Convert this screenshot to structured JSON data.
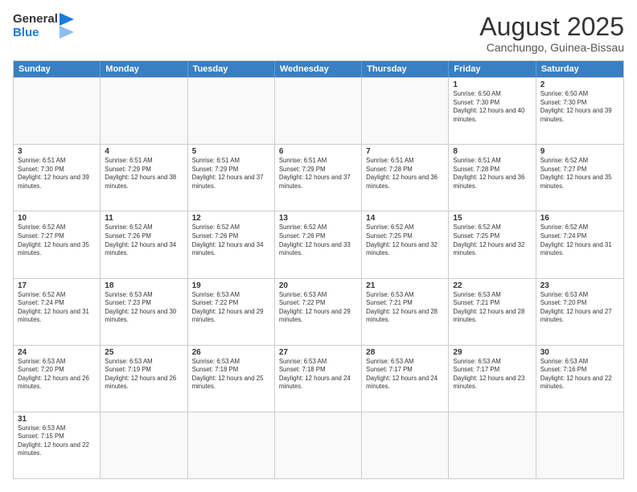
{
  "header": {
    "logo_general": "General",
    "logo_blue": "Blue",
    "month_year": "August 2025",
    "location": "Canchungo, Guinea-Bissau"
  },
  "weekdays": [
    "Sunday",
    "Monday",
    "Tuesday",
    "Wednesday",
    "Thursday",
    "Friday",
    "Saturday"
  ],
  "weeks": [
    [
      {
        "day": "",
        "info": ""
      },
      {
        "day": "",
        "info": ""
      },
      {
        "day": "",
        "info": ""
      },
      {
        "day": "",
        "info": ""
      },
      {
        "day": "",
        "info": ""
      },
      {
        "day": "1",
        "info": "Sunrise: 6:50 AM\nSunset: 7:30 PM\nDaylight: 12 hours and 40 minutes."
      },
      {
        "day": "2",
        "info": "Sunrise: 6:50 AM\nSunset: 7:30 PM\nDaylight: 12 hours and 39 minutes."
      }
    ],
    [
      {
        "day": "3",
        "info": "Sunrise: 6:51 AM\nSunset: 7:30 PM\nDaylight: 12 hours and 39 minutes."
      },
      {
        "day": "4",
        "info": "Sunrise: 6:51 AM\nSunset: 7:29 PM\nDaylight: 12 hours and 38 minutes."
      },
      {
        "day": "5",
        "info": "Sunrise: 6:51 AM\nSunset: 7:29 PM\nDaylight: 12 hours and 37 minutes."
      },
      {
        "day": "6",
        "info": "Sunrise: 6:51 AM\nSunset: 7:29 PM\nDaylight: 12 hours and 37 minutes."
      },
      {
        "day": "7",
        "info": "Sunrise: 6:51 AM\nSunset: 7:28 PM\nDaylight: 12 hours and 36 minutes."
      },
      {
        "day": "8",
        "info": "Sunrise: 6:51 AM\nSunset: 7:28 PM\nDaylight: 12 hours and 36 minutes."
      },
      {
        "day": "9",
        "info": "Sunrise: 6:52 AM\nSunset: 7:27 PM\nDaylight: 12 hours and 35 minutes."
      }
    ],
    [
      {
        "day": "10",
        "info": "Sunrise: 6:52 AM\nSunset: 7:27 PM\nDaylight: 12 hours and 35 minutes."
      },
      {
        "day": "11",
        "info": "Sunrise: 6:52 AM\nSunset: 7:26 PM\nDaylight: 12 hours and 34 minutes."
      },
      {
        "day": "12",
        "info": "Sunrise: 6:52 AM\nSunset: 7:26 PM\nDaylight: 12 hours and 34 minutes."
      },
      {
        "day": "13",
        "info": "Sunrise: 6:52 AM\nSunset: 7:26 PM\nDaylight: 12 hours and 33 minutes."
      },
      {
        "day": "14",
        "info": "Sunrise: 6:52 AM\nSunset: 7:25 PM\nDaylight: 12 hours and 32 minutes."
      },
      {
        "day": "15",
        "info": "Sunrise: 6:52 AM\nSunset: 7:25 PM\nDaylight: 12 hours and 32 minutes."
      },
      {
        "day": "16",
        "info": "Sunrise: 6:52 AM\nSunset: 7:24 PM\nDaylight: 12 hours and 31 minutes."
      }
    ],
    [
      {
        "day": "17",
        "info": "Sunrise: 6:52 AM\nSunset: 7:24 PM\nDaylight: 12 hours and 31 minutes."
      },
      {
        "day": "18",
        "info": "Sunrise: 6:53 AM\nSunset: 7:23 PM\nDaylight: 12 hours and 30 minutes."
      },
      {
        "day": "19",
        "info": "Sunrise: 6:53 AM\nSunset: 7:22 PM\nDaylight: 12 hours and 29 minutes."
      },
      {
        "day": "20",
        "info": "Sunrise: 6:53 AM\nSunset: 7:22 PM\nDaylight: 12 hours and 29 minutes."
      },
      {
        "day": "21",
        "info": "Sunrise: 6:53 AM\nSunset: 7:21 PM\nDaylight: 12 hours and 28 minutes."
      },
      {
        "day": "22",
        "info": "Sunrise: 6:53 AM\nSunset: 7:21 PM\nDaylight: 12 hours and 28 minutes."
      },
      {
        "day": "23",
        "info": "Sunrise: 6:53 AM\nSunset: 7:20 PM\nDaylight: 12 hours and 27 minutes."
      }
    ],
    [
      {
        "day": "24",
        "info": "Sunrise: 6:53 AM\nSunset: 7:20 PM\nDaylight: 12 hours and 26 minutes."
      },
      {
        "day": "25",
        "info": "Sunrise: 6:53 AM\nSunset: 7:19 PM\nDaylight: 12 hours and 26 minutes."
      },
      {
        "day": "26",
        "info": "Sunrise: 6:53 AM\nSunset: 7:18 PM\nDaylight: 12 hours and 25 minutes."
      },
      {
        "day": "27",
        "info": "Sunrise: 6:53 AM\nSunset: 7:18 PM\nDaylight: 12 hours and 24 minutes."
      },
      {
        "day": "28",
        "info": "Sunrise: 6:53 AM\nSunset: 7:17 PM\nDaylight: 12 hours and 24 minutes."
      },
      {
        "day": "29",
        "info": "Sunrise: 6:53 AM\nSunset: 7:17 PM\nDaylight: 12 hours and 23 minutes."
      },
      {
        "day": "30",
        "info": "Sunrise: 6:53 AM\nSunset: 7:16 PM\nDaylight: 12 hours and 22 minutes."
      }
    ],
    [
      {
        "day": "31",
        "info": "Sunrise: 6:53 AM\nSunset: 7:15 PM\nDaylight: 12 hours and 22 minutes."
      },
      {
        "day": "",
        "info": ""
      },
      {
        "day": "",
        "info": ""
      },
      {
        "day": "",
        "info": ""
      },
      {
        "day": "",
        "info": ""
      },
      {
        "day": "",
        "info": ""
      },
      {
        "day": "",
        "info": ""
      }
    ]
  ]
}
